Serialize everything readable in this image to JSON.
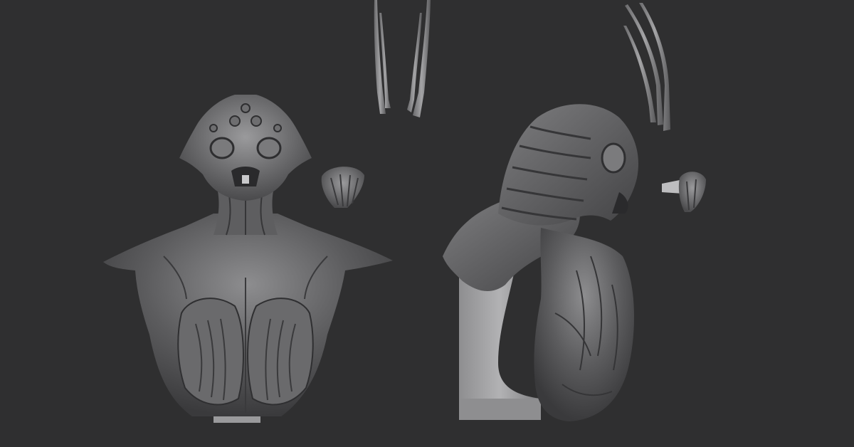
{
  "viewport": {
    "background": "#2f2f30",
    "description_visible_text": ""
  },
  "colors": {
    "clay_dark": "#3e3e40",
    "clay_mid": "#5a5a5c",
    "clay_light": "#8a8a8c",
    "highlight": "#b5b5b7",
    "base_plinth": "#a7a7a9"
  }
}
